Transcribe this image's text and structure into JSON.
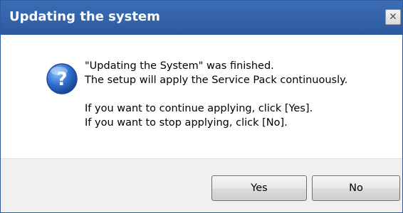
{
  "window": {
    "title": "Updating the system",
    "close_symbol": "✕"
  },
  "icon": {
    "name": "question-icon",
    "glyph": "?",
    "color": "#2f6fd0"
  },
  "message": {
    "line1": "\"Updating the System\" was finished.",
    "line2": "The setup will apply the Service Pack continuously.",
    "line3": "If you want to continue applying, click [Yes].",
    "line4": "If you want to stop applying, click [No]."
  },
  "buttons": {
    "yes": "Yes",
    "no": "No"
  }
}
